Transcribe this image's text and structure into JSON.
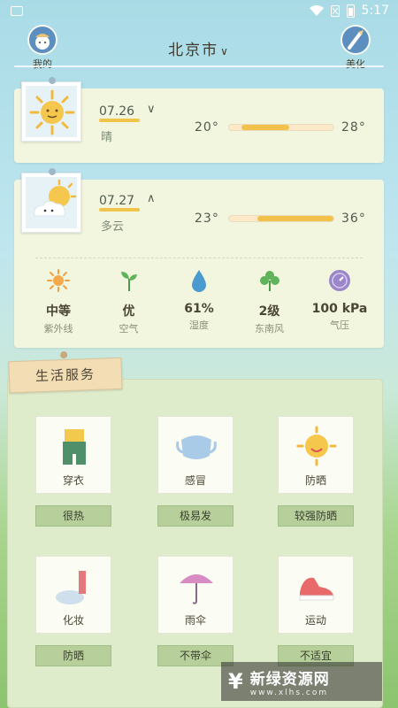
{
  "status_bar": {
    "time": "5:17"
  },
  "header": {
    "city": "北京市",
    "left_label": "我的",
    "right_label": "美化"
  },
  "forecast": [
    {
      "date": "07.26",
      "weather": "晴",
      "low": "20°",
      "high": "28°",
      "bar_start": 0.12,
      "bar_end": 0.58,
      "expand": "∨"
    },
    {
      "date": "07.27",
      "weather": "多云",
      "low": "23°",
      "high": "36°",
      "bar_start": 0.27,
      "bar_end": 1.0,
      "expand": "∧"
    }
  ],
  "metrics": [
    {
      "value": "中等",
      "label": "紫外线",
      "icon": "sun-icon"
    },
    {
      "value": "优",
      "label": "空气",
      "icon": "sprout-icon"
    },
    {
      "value": "61%",
      "label": "湿度",
      "icon": "water-drop-icon"
    },
    {
      "value": "2级",
      "label": "东南风",
      "icon": "clover-icon"
    },
    {
      "value": "100 kPa",
      "label": "气压",
      "icon": "pressure-icon"
    }
  ],
  "life_service": {
    "title": "生活服务",
    "items": [
      {
        "name": "穿衣",
        "tag": "很热",
        "icon": "clothes-icon"
      },
      {
        "name": "感冒",
        "tag": "极易发",
        "icon": "mask-icon"
      },
      {
        "name": "防晒",
        "tag": "较强防晒",
        "icon": "sun-face-icon"
      },
      {
        "name": "化妆",
        "tag": "防晒",
        "icon": "makeup-icon"
      },
      {
        "name": "雨伞",
        "tag": "不带伞",
        "icon": "umbrella-icon"
      },
      {
        "name": "运动",
        "tag": "不适宜",
        "icon": "sneaker-icon"
      }
    ]
  },
  "watermark": {
    "title": "新绿资源网",
    "url": "www.xlhs.com"
  }
}
